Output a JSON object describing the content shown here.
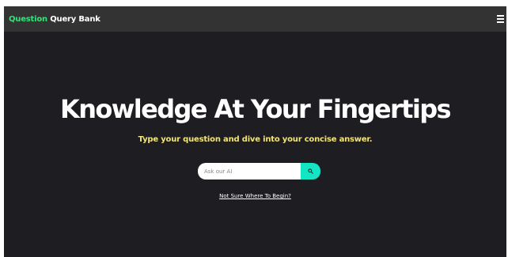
{
  "navbar": {
    "brand_accent": "Question",
    "brand_rest": " Query Bank",
    "menu_icon": "hamburger-menu-icon"
  },
  "hero": {
    "title": "Knowledge At Your Fingertips",
    "subtitle": "Type your question and dive into your concise answer."
  },
  "search": {
    "placeholder": "Ask our AI",
    "value": "",
    "button_icon": "search-icon"
  },
  "help_link": "Not Sure Where To Begin?",
  "colors": {
    "background": "#1e1e22",
    "navbar": "#333333",
    "brand_accent": "#39e07a",
    "subtitle": "#f2e47a",
    "search_button": "#14e6c4"
  }
}
